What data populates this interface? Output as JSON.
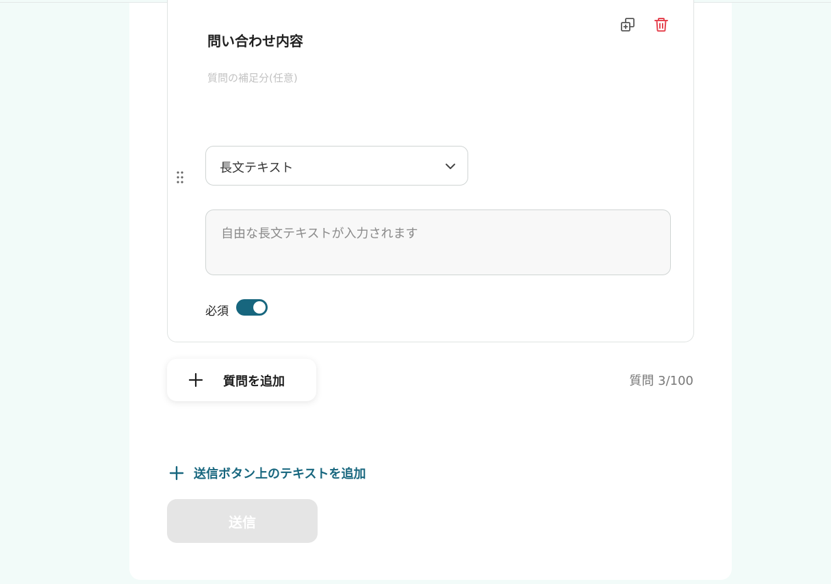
{
  "question": {
    "title": "問い合わせ内容",
    "description_placeholder": "質問の補足分(任意)",
    "type_select": {
      "selected": "長文テキスト"
    },
    "answer_placeholder": "自由な長文テキストが入力されます",
    "required": {
      "label": "必須",
      "enabled": true
    }
  },
  "actions": {
    "add_question_label": "質問を追加",
    "question_count": "質問 3/100",
    "add_text_label": "送信ボタン上のテキストを追加",
    "submit_label": "送信"
  },
  "colors": {
    "accent": "#17667e",
    "danger": "#e5434f",
    "page_background": "#f2fbf9",
    "disabled_button": "#e5e5e5"
  },
  "icons": {
    "duplicate": "copy-plus-icon",
    "delete": "trash-icon",
    "drag": "drag-handle-icon",
    "dropdown": "chevron-down-icon",
    "add": "plus-icon"
  }
}
